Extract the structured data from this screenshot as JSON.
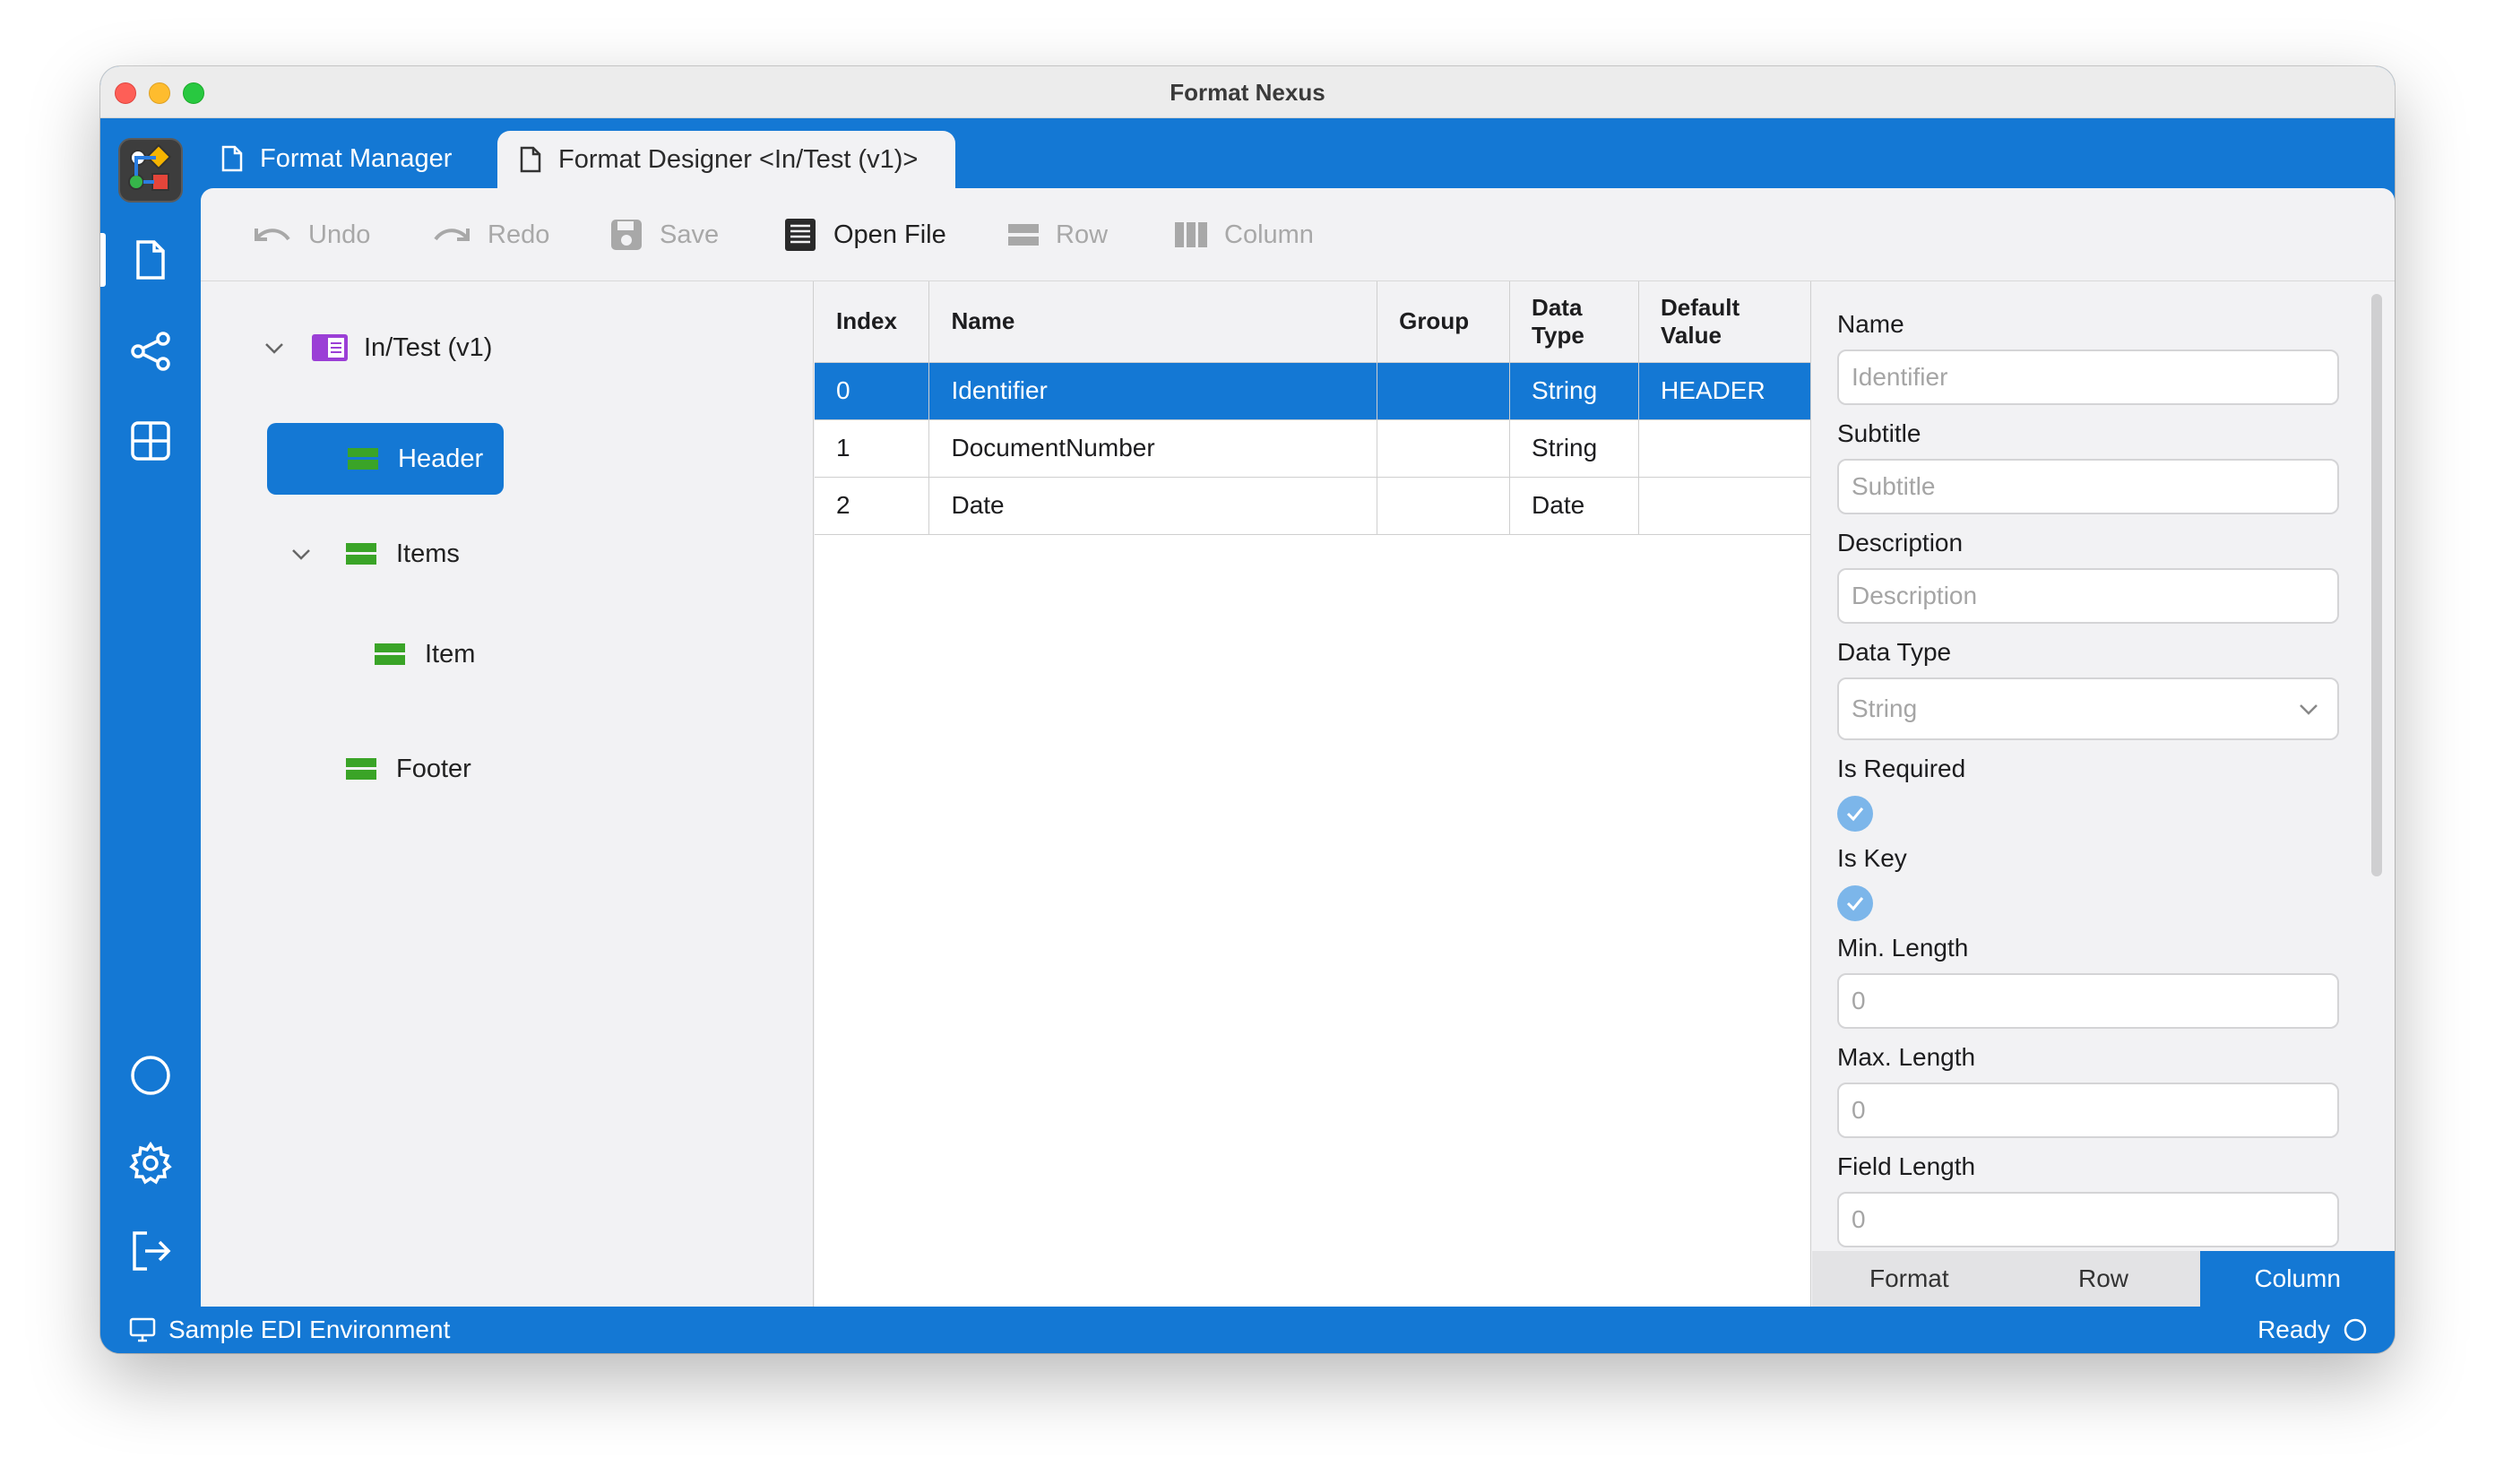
{
  "window": {
    "title": "Format Nexus"
  },
  "tabs": [
    {
      "label": "Format Manager",
      "icon": "document-icon"
    },
    {
      "label": "Format Designer <In/Test (v1)>",
      "icon": "document-icon"
    }
  ],
  "toolbar": {
    "undo": "Undo",
    "redo": "Redo",
    "save": "Save",
    "open_file": "Open File",
    "row": "Row",
    "column": "Column"
  },
  "tree": {
    "root": "In/Test (v1)",
    "nodes": [
      "Header",
      "Items",
      "Item",
      "Footer"
    ]
  },
  "grid": {
    "headers": [
      "Index",
      "Name",
      "Group",
      "Data\nType",
      "Default\nValue"
    ],
    "header_index": "Index",
    "header_name": "Name",
    "header_group": "Group",
    "header_datatype_1": "Data",
    "header_datatype_2": "Type",
    "header_default_1": "Default",
    "header_default_2": "Value",
    "rows": [
      {
        "index": "0",
        "name": "Identifier",
        "group": "",
        "data_type": "String",
        "default_value": "HEADER"
      },
      {
        "index": "1",
        "name": "DocumentNumber",
        "group": "",
        "data_type": "String",
        "default_value": ""
      },
      {
        "index": "2",
        "name": "Date",
        "group": "",
        "data_type": "Date",
        "default_value": ""
      }
    ]
  },
  "properties": {
    "name_label": "Name",
    "name_value": "Identifier",
    "subtitle_label": "Subtitle",
    "subtitle_placeholder": "Subtitle",
    "description_label": "Description",
    "description_placeholder": "Description",
    "datatype_label": "Data Type",
    "datatype_value": "String",
    "is_required_label": "Is Required",
    "is_required": true,
    "is_key_label": "Is Key",
    "is_key": true,
    "min_length_label": "Min. Length",
    "min_length": "0",
    "max_length_label": "Max. Length",
    "max_length": "0",
    "field_length_label": "Field Length",
    "field_length": "0"
  },
  "bottom_tabs": [
    "Format",
    "Row",
    "Column"
  ],
  "bottom_tab_active": "Column",
  "status": {
    "environment": "Sample EDI Environment",
    "state": "Ready"
  },
  "colors": {
    "accent": "#1478d4",
    "row_icon_green": "#3aa427",
    "format_icon_purple": "#9b3fd6"
  }
}
